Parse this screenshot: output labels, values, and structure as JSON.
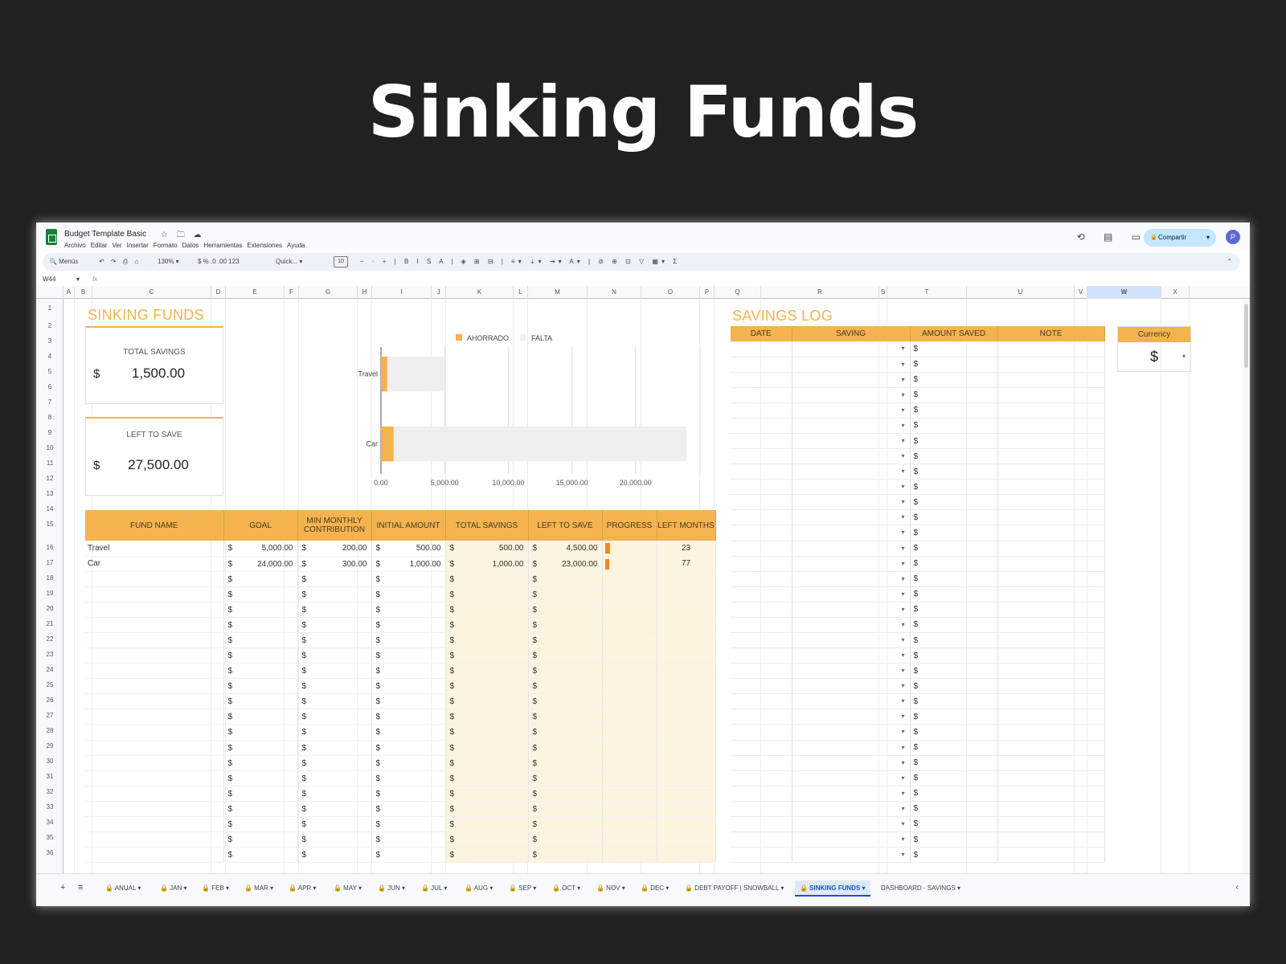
{
  "hero_title": "Sinking Funds",
  "app": {
    "doc_title": "Budget Template Basic",
    "title_icons": "☆ 🗀 ☁",
    "menus": [
      "Archivo",
      "Editar",
      "Ver",
      "Insertar",
      "Formato",
      "Datos",
      "Herramientas",
      "Extensiones",
      "Ayuda"
    ],
    "share_label": "Compartir",
    "avatar": "P",
    "top_icons": "⟲ ▤ ▭▾"
  },
  "toolbar": {
    "search": "🔍 Menús",
    "tools": "↶ ↷ ⎙ ⌂",
    "zoom": "130% ▾",
    "font": "Quick... ▾",
    "font_size": "10",
    "more": "− · + | B I S A | ◈ ⊞ ⊟ | ≡▾ ⇣▾ ⇥▾ A▾ | ⊘ ⊕ ⊡ ▽ ▦▾ Σ",
    "format_tools": "$  %  .0  .00  123",
    "collapse": "⌃"
  },
  "formula_bar": {
    "cell_ref": "W44",
    "arrow": "▾",
    "fx": "fx"
  },
  "columns": [
    "A",
    "B",
    "C",
    "D",
    "E",
    "F",
    "G",
    "H",
    "I",
    "J",
    "K",
    "L",
    "M",
    "N",
    "O",
    "P",
    "Q",
    "R",
    "S",
    "T",
    "U",
    "V",
    "W",
    "X"
  ],
  "rows": [
    "1",
    "2",
    "3",
    "4",
    "5",
    "6",
    "7",
    "8",
    "9",
    "10",
    "11",
    "12",
    "13",
    "14",
    "15",
    "16",
    "17",
    "18",
    "19",
    "20",
    "21",
    "22",
    "23",
    "24",
    "25",
    "26",
    "27",
    "28",
    "29",
    "30",
    "31",
    "32",
    "33",
    "34",
    "35",
    "36"
  ],
  "sheet": {
    "title": "SINKING FUNDS",
    "total_savings": {
      "label": "TOTAL SAVINGS",
      "currency": "$",
      "value": "1,500.00"
    },
    "left_to_save": {
      "label": "LEFT TO SAVE",
      "currency": "$",
      "value": "27,500.00"
    },
    "log_title": "SAVINGS LOG",
    "log_headers": [
      "DATE",
      "SAVING",
      "AMOUNT SAVED",
      "NOTE"
    ],
    "currency_label": "Currency",
    "currency_value": "$",
    "currency_dropdown": "▾",
    "dropdown_glyph": "▾",
    "currency_symbol": "$"
  },
  "fund_table": {
    "headers": [
      "FUND NAME",
      "GOAL",
      "MIN MONTHLY CONTRIBUTION",
      "INITIAL AMOUNT",
      "TOTAL SAVINGS",
      "LEFT TO SAVE",
      "PROGRESS",
      "LEFT MONTHS"
    ],
    "rows": [
      {
        "name": "Travel",
        "goal": "5,000.00",
        "min": "200.00",
        "initial": "500.00",
        "total": "500.00",
        "left": "4,500.00",
        "progress": 0.1,
        "months": "23"
      },
      {
        "name": "Car",
        "goal": "24,000.00",
        "min": "300.00",
        "initial": "1,000.00",
        "total": "1,000.00",
        "left": "23,000.00",
        "progress": 0.042,
        "months": "77"
      }
    ]
  },
  "chart_data": {
    "type": "bar",
    "orientation": "horizontal",
    "stacked": true,
    "categories": [
      "Travel",
      "Car"
    ],
    "series": [
      {
        "name": "AHORRADO",
        "values": [
          500,
          1000
        ],
        "color": "#f3b34f"
      },
      {
        "name": "FALTA",
        "values": [
          4500,
          23000
        ],
        "color": "#efefef"
      }
    ],
    "xlim": [
      0,
      25000
    ],
    "ticks": [
      "0.00",
      "5,000.00",
      "10,000.00",
      "15,000.00",
      "20,000.00"
    ],
    "tick_values": [
      0,
      5000,
      10000,
      15000,
      20000
    ],
    "grid": true,
    "legend": "top"
  },
  "tabs": {
    "add": "+",
    "list": "≡",
    "collapse": "‹",
    "items": [
      {
        "label": "🔒 ANUAL ▾",
        "active": false
      },
      {
        "label": "🔒 JAN ▾",
        "active": false
      },
      {
        "label": "🔒 FEB ▾",
        "active": false
      },
      {
        "label": "🔒 MAR ▾",
        "active": false
      },
      {
        "label": "🔒 APR ▾",
        "active": false
      },
      {
        "label": "🔒 MAY ▾",
        "active": false
      },
      {
        "label": "🔒 JUN ▾",
        "active": false
      },
      {
        "label": "🔒 JUL ▾",
        "active": false
      },
      {
        "label": "🔒 AUG ▾",
        "active": false
      },
      {
        "label": "🔒 SEP ▾",
        "active": false
      },
      {
        "label": "🔒 OCT ▾",
        "active": false
      },
      {
        "label": "🔒 NOV ▾",
        "active": false
      },
      {
        "label": "🔒 DEC ▾",
        "active": false
      },
      {
        "label": "🔒 DEBT PAYOFF | SNOWBALL ▾",
        "active": false
      },
      {
        "label": "🔒 SINKING FUNDS ▾",
        "active": true
      },
      {
        "label": "DASHBOARD - SAVINGS ▾",
        "active": false
      }
    ]
  }
}
